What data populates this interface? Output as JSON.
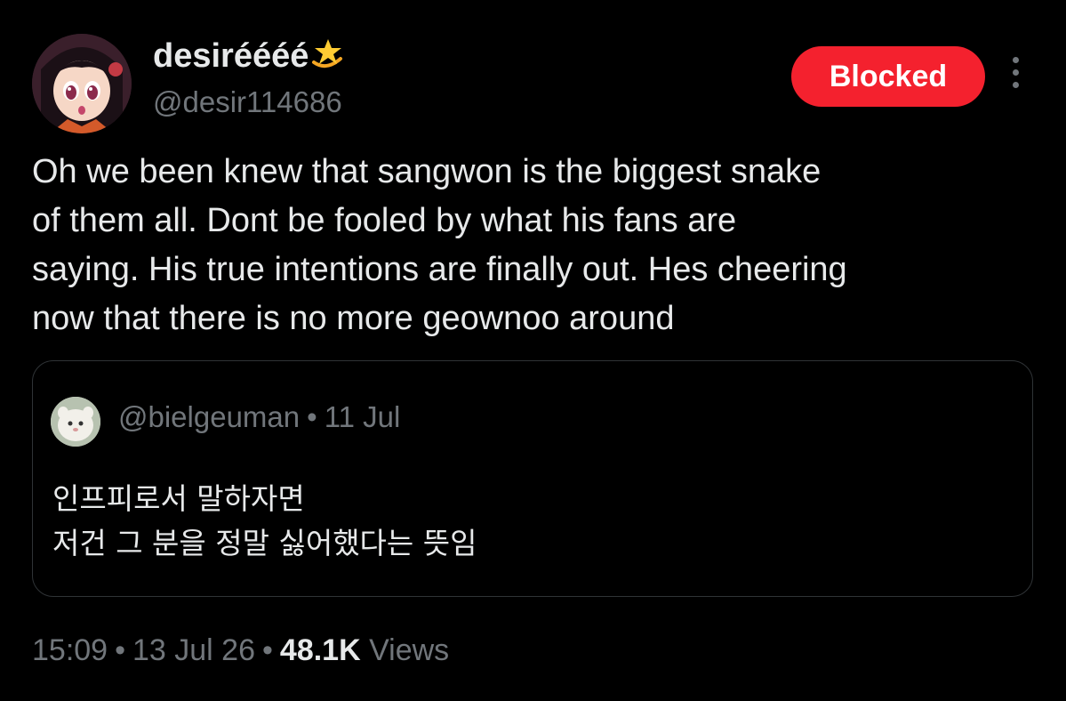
{
  "author": {
    "display_name": "desiréééé",
    "name_emoji": "dizzy-star-icon",
    "handle": "@desir114686",
    "avatar": "anime-girl-avatar"
  },
  "actions": {
    "blocked_label": "Blocked",
    "more_icon": "more-vertical-icon"
  },
  "tweet": {
    "text": "Oh we been knew that sangwon is the biggest snake\nof them all. Dont be fooled by what his fans are\nsaying. His true intentions are finally out. Hes cheering\nnow that there is no more geownoo around"
  },
  "quote": {
    "handle": "@bielgeuman",
    "separator": "•",
    "date": "11 Jul",
    "text": "인프피로서 말하자면\n저건 그 분을 정말 싫어했다는 뜻임",
    "avatar": "plush-toy-avatar"
  },
  "footer": {
    "time": "15:09",
    "separator": "•",
    "date": "13 Jul 26",
    "views_count": "48.1K",
    "views_label": "Views"
  },
  "colors": {
    "background": "#000000",
    "text_primary": "#e7e9ea",
    "text_secondary": "#71767b",
    "blocked_red": "#f4212e",
    "border": "#2f3336"
  }
}
